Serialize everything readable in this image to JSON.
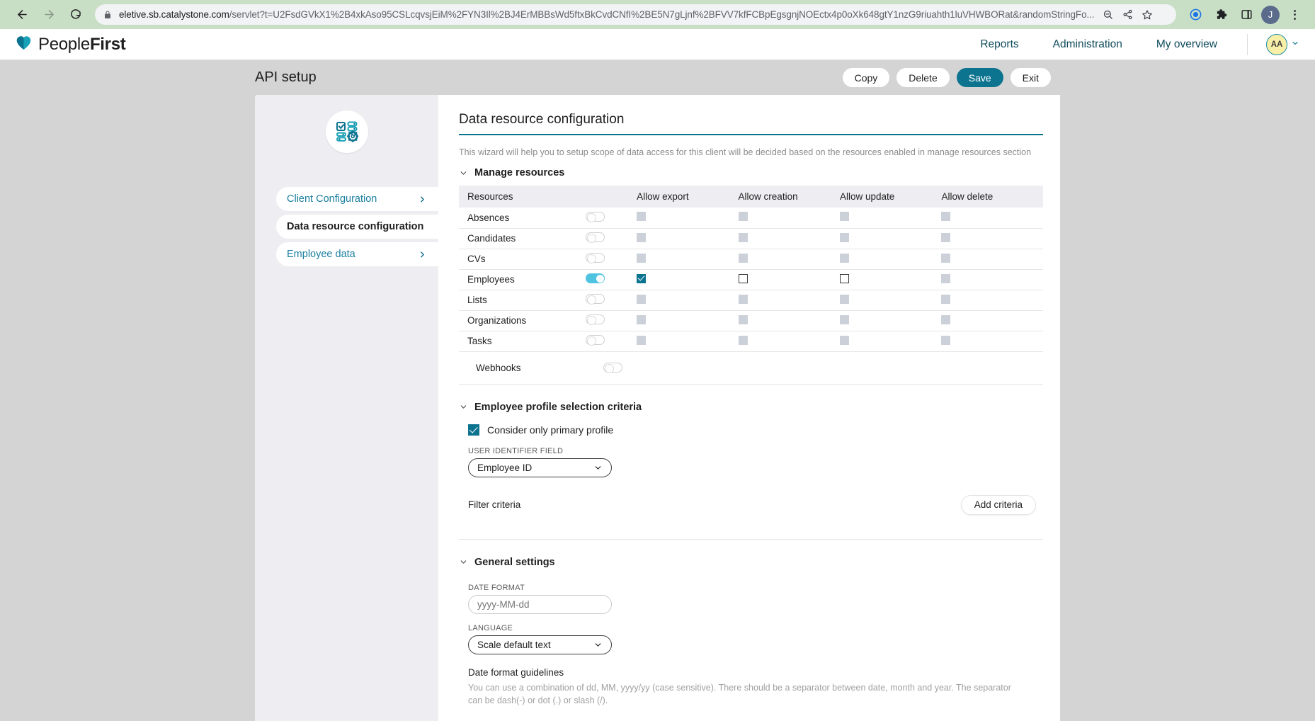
{
  "browser": {
    "url_host": "eletive.sb.catalystone.com",
    "url_path": "/servlet?t=U2FsdGVkX1%2B4xkAso95CSLcqvsjEiM%2FYN3Il%2BJ4ErMBBsWd5ftxBkCvdCNfI%2BE5N7gLjnf%2BFVV7kfFCBpEgsgnjNOEctx4p0oXk648gtY1nzG9riuahth1luVHWBORat&randomStringFo...",
    "icons": {
      "back": "back-arrow-icon",
      "forward": "forward-arrow-icon",
      "reload": "reload-icon",
      "lock": "lock-icon",
      "zoom": "zoom-out-icon",
      "share": "share-icon",
      "bookmark": "star-icon",
      "extension": "puzzle-icon",
      "sidepanel": "side-panel-icon",
      "menu": "kebab-menu-icon"
    },
    "profile_initial": "J"
  },
  "header": {
    "logo_light": "People",
    "logo_bold": "First",
    "nav": [
      {
        "label": "Reports"
      },
      {
        "label": "Administration"
      },
      {
        "label": "My overview"
      }
    ],
    "avatar_initials": "AA"
  },
  "toolbar": {
    "page_title": "API setup",
    "buttons": [
      {
        "label": "Copy",
        "primary": false
      },
      {
        "label": "Delete",
        "primary": false
      },
      {
        "label": "Save",
        "primary": true
      },
      {
        "label": "Exit",
        "primary": false
      }
    ]
  },
  "sidebar": {
    "icon": "settings-grid-icon",
    "items": [
      {
        "label": "Client Configuration",
        "active": false,
        "chevron": true
      },
      {
        "label": "Data resource configuration",
        "active": true,
        "chevron": false
      },
      {
        "label": "Employee data",
        "active": false,
        "chevron": true
      }
    ]
  },
  "main": {
    "title": "Data resource configuration",
    "wizard_note": "This wizard will help you to setup scope of data access for this client will be decided based on the resources enabled in manage resources section",
    "manage_resources": {
      "section_label": "Manage resources",
      "columns": [
        "Resources",
        "",
        "Allow export",
        "Allow creation",
        "Allow update",
        "Allow delete"
      ],
      "rows": [
        {
          "name": "Absences",
          "enabled": false,
          "export": "disabled",
          "creation": "disabled",
          "update": "disabled",
          "delete": "disabled"
        },
        {
          "name": "Candidates",
          "enabled": false,
          "export": "disabled",
          "creation": "disabled",
          "update": "disabled",
          "delete": "disabled"
        },
        {
          "name": "CVs",
          "enabled": false,
          "export": "disabled",
          "creation": "disabled",
          "update": "disabled",
          "delete": "disabled"
        },
        {
          "name": "Employees",
          "enabled": true,
          "export": "checked",
          "creation": "unchecked",
          "update": "unchecked",
          "delete": "disabled"
        },
        {
          "name": "Lists",
          "enabled": false,
          "export": "disabled",
          "creation": "disabled",
          "update": "disabled",
          "delete": "disabled"
        },
        {
          "name": "Organizations",
          "enabled": false,
          "export": "disabled",
          "creation": "disabled",
          "update": "disabled",
          "delete": "disabled"
        },
        {
          "name": "Tasks",
          "enabled": false,
          "export": "disabled",
          "creation": "disabled",
          "update": "disabled",
          "delete": "disabled"
        }
      ],
      "webhooks": {
        "name": "Webhooks",
        "enabled": false
      }
    },
    "profile_criteria": {
      "section_label": "Employee profile selection criteria",
      "primary_profile_label": "Consider only primary profile",
      "primary_profile_checked": true,
      "user_identifier_label": "USER IDENTIFIER FIELD",
      "user_identifier_value": "Employee ID",
      "filter_criteria_label": "Filter criteria",
      "add_criteria_label": "Add criteria"
    },
    "general_settings": {
      "section_label": "General settings",
      "date_format_label": "DATE FORMAT",
      "date_format_value": "",
      "date_format_placeholder": "yyyy-MM-dd",
      "language_label": "LANGUAGE",
      "language_value": "Scale default text",
      "guidelines_title": "Date format guidelines",
      "guidelines_text": "You can use a combination of dd, MM, yyyy/yy (case sensitive). There should be a separator between date, month and year. The separator can be dash(-) or dot (.) or slash (/)."
    }
  },
  "colors": {
    "brand_teal": "#0d7490",
    "toggle_on": "#50c3e0",
    "link_teal": "#1b7f9e",
    "browser_chrome": "#c9dfc5"
  }
}
